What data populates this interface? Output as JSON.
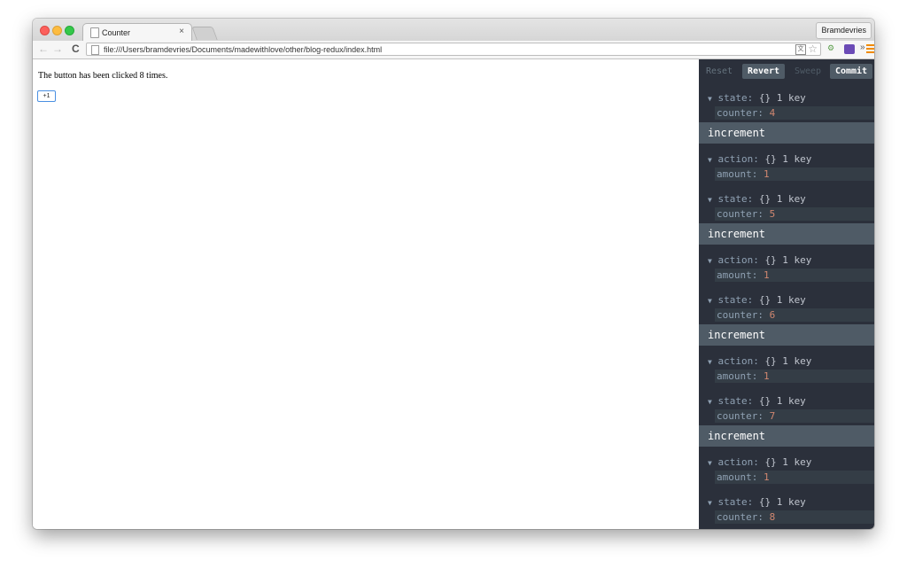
{
  "browser": {
    "tab_title": "Counter",
    "tab_close": "×",
    "profile_name": "Bramdevries",
    "url": "file:///Users/bramdevries/Documents/madewithlove/other/blog-redux/index.html",
    "nav_back": "←",
    "nav_forward": "→",
    "reload": "C",
    "translate_glyph": "文",
    "star_glyph": "☆",
    "ext_more": "»",
    "ext_puzzle": "⚙",
    "colors": {
      "menu_accent": "#f08a00",
      "redux_ext": "#6b4bb6"
    }
  },
  "page": {
    "message": "The button has been clicked 8 times.",
    "button_label": "+1"
  },
  "devtools": {
    "toolbar": {
      "reset": "Reset",
      "revert": "Revert",
      "sweep": "Sweep",
      "commit": "Commit"
    },
    "initial_state": {
      "key": "state:",
      "meta": "{} 1 key",
      "prop": "counter:",
      "value": "4"
    },
    "actions": [
      {
        "type": "increment",
        "action": {
          "key": "action:",
          "meta": "{} 1 key",
          "prop": "amount:",
          "value": "1"
        },
        "state": {
          "key": "state:",
          "meta": "{} 1 key",
          "prop": "counter:",
          "value": "5"
        }
      },
      {
        "type": "increment",
        "action": {
          "key": "action:",
          "meta": "{} 1 key",
          "prop": "amount:",
          "value": "1"
        },
        "state": {
          "key": "state:",
          "meta": "{} 1 key",
          "prop": "counter:",
          "value": "6"
        }
      },
      {
        "type": "increment",
        "action": {
          "key": "action:",
          "meta": "{} 1 key",
          "prop": "amount:",
          "value": "1"
        },
        "state": {
          "key": "state:",
          "meta": "{} 1 key",
          "prop": "counter:",
          "value": "7"
        }
      },
      {
        "type": "increment",
        "action": {
          "key": "action:",
          "meta": "{} 1 key",
          "prop": "amount:",
          "value": "1"
        },
        "state": {
          "key": "state:",
          "meta": "{} 1 key",
          "prop": "counter:",
          "value": "8"
        }
      }
    ],
    "colors": {
      "bg": "#2b303b",
      "row": "#343d46",
      "header": "#4f5b66",
      "key": "#8fa1b3",
      "value": "#d08770"
    }
  }
}
